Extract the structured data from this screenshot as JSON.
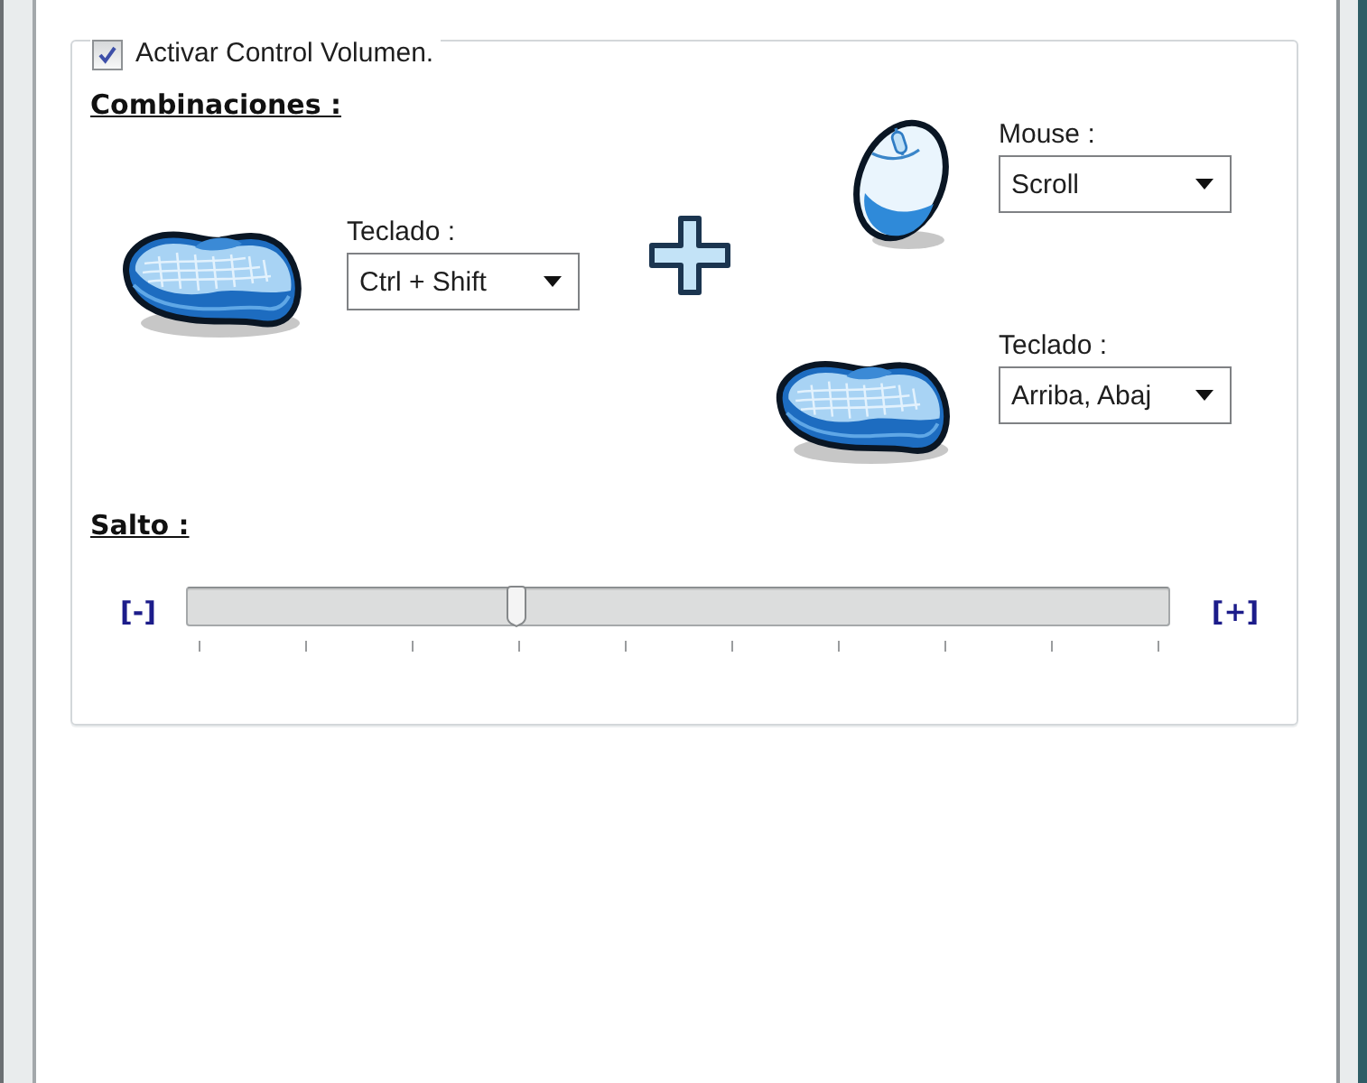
{
  "enable": {
    "label": "Activar Control Volumen.",
    "checked": true
  },
  "combinations": {
    "heading": "Combinaciones :",
    "primary": {
      "kind": "keyboard",
      "label": "Teclado :",
      "value": "Ctrl + Shift"
    },
    "secondary": [
      {
        "kind": "mouse",
        "label": "Mouse :",
        "value": "Scroll"
      },
      {
        "kind": "keyboard",
        "label": "Teclado :",
        "value": "Arriba, Abaj"
      }
    ]
  },
  "step": {
    "heading": "Salto :",
    "decrease": "[-]",
    "increase": "[+]",
    "level": 0.333
  }
}
